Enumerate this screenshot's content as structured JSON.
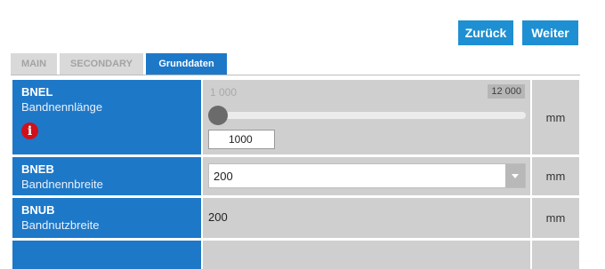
{
  "nav": {
    "back_label": "Zurück",
    "next_label": "Weiter"
  },
  "tabs": [
    {
      "label": "MAIN",
      "active": false
    },
    {
      "label": "SECONDARY",
      "active": false
    },
    {
      "label": "Grunddaten",
      "active": true
    }
  ],
  "fields": {
    "bnel": {
      "code": "BNEL",
      "description": "Bandnennlänge",
      "icon": "info-icon",
      "min_label": "1 000",
      "max_label": "12 000",
      "slider_value": 1000,
      "input_value": "1000",
      "unit": "mm"
    },
    "bneb": {
      "code": "BNEB",
      "description": "Bandnennbreite",
      "selected": "200",
      "unit": "mm"
    },
    "bnub": {
      "code": "BNUB",
      "description": "Bandnutzbreite",
      "value": "200",
      "unit": "mm"
    }
  },
  "colors": {
    "accent": "#1e8fd2",
    "label_bg": "#1e78c8",
    "cell_bg": "#cfcfcf",
    "warning": "#d0101a"
  }
}
